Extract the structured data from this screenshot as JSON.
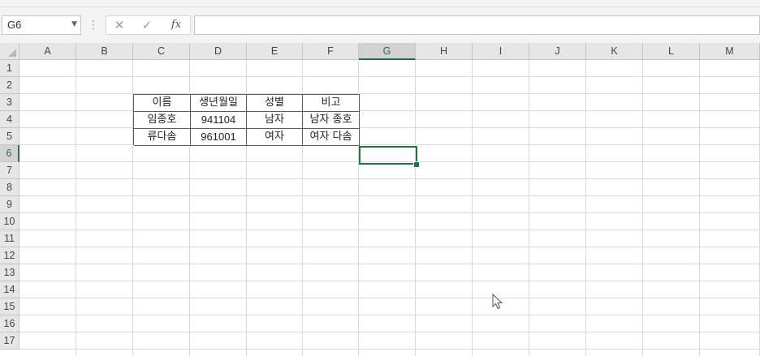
{
  "formula_bar": {
    "name_box": "G6",
    "cancel_icon": "close-icon",
    "enter_icon": "checkmark-icon",
    "function_label": "fx",
    "formula_value": ""
  },
  "columns": [
    "A",
    "B",
    "C",
    "D",
    "E",
    "F",
    "G",
    "H",
    "I",
    "J",
    "K",
    "L",
    "M"
  ],
  "rows": [
    "1",
    "2",
    "3",
    "4",
    "5",
    "6",
    "7",
    "8",
    "9",
    "10",
    "11",
    "12",
    "13",
    "14",
    "15",
    "16",
    "17"
  ],
  "selected_cell": {
    "column": "G",
    "row": "6"
  },
  "table": {
    "headers": [
      "이름",
      "생년월일",
      "성별",
      "비고"
    ],
    "rows": [
      [
        "임종호",
        "941104",
        "남자",
        "남자 종호"
      ],
      [
        "류다솜",
        "961001",
        "여자",
        "여자 다솜"
      ]
    ]
  },
  "colors": {
    "accent": "#217346",
    "header_bg": "#e6e6e6",
    "gridline": "#dadada",
    "table_border": "#5b5b5b"
  }
}
